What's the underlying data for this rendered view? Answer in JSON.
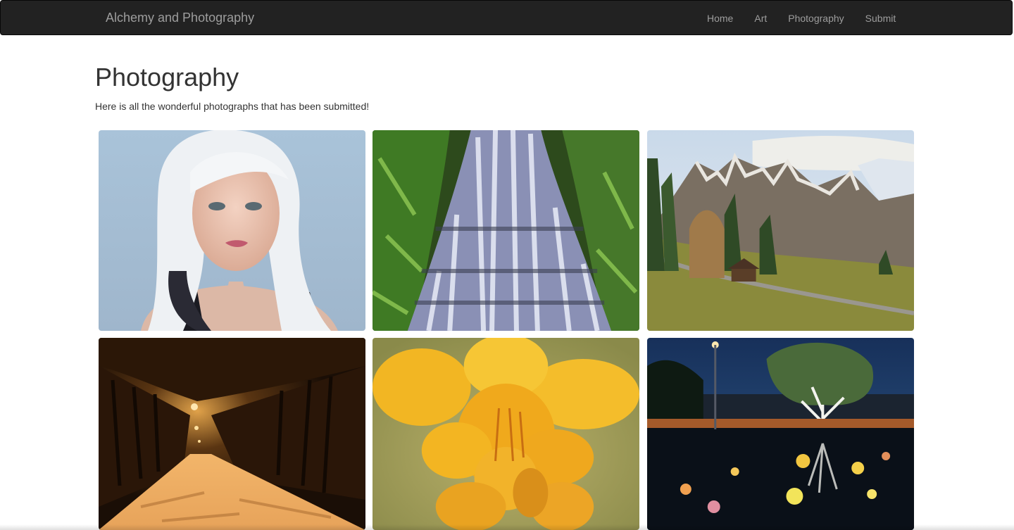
{
  "navbar": {
    "brand": "Alchemy and Photography",
    "links": [
      {
        "label": "Home"
      },
      {
        "label": "Art"
      },
      {
        "label": "Photography"
      },
      {
        "label": "Submit"
      }
    ]
  },
  "page": {
    "title": "Photography",
    "description": "Here is all the wonderful photographs that has been submitted!"
  },
  "gallery": {
    "photos": [
      {
        "subject": "portrait of a woman with platinum blonde hair"
      },
      {
        "subject": "waterfall cascading through green ferns"
      },
      {
        "subject": "alpine mountain valley with wooden hut"
      },
      {
        "subject": "snowy tree-lined road lit by street lamps at night"
      },
      {
        "subject": "close-up of yellow flower blossoms"
      },
      {
        "subject": "illuminated tree and glowing spheres reflected in water at night"
      }
    ]
  }
}
